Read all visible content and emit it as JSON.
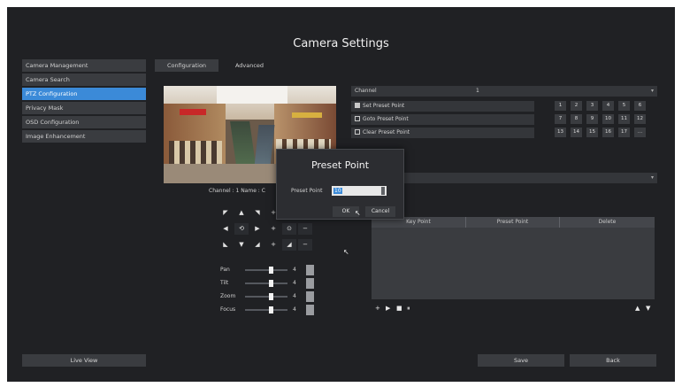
{
  "window": {
    "title": "Camera Settings"
  },
  "menu": {
    "items": [
      {
        "label": "Camera Management",
        "active": false
      },
      {
        "label": "Camera Search",
        "active": false
      },
      {
        "label": "PTZ Configuration",
        "active": true
      },
      {
        "label": "Privacy Mask",
        "active": false
      },
      {
        "label": "OSD Configuration",
        "active": false
      },
      {
        "label": "Image Enhancement",
        "active": false
      }
    ]
  },
  "tabs": [
    {
      "label": "Configuration"
    },
    {
      "label": "Advanced"
    }
  ],
  "preview": {
    "caption": "Channel : 1 Name : C"
  },
  "ptz_pad": {
    "rows": [
      [
        "◤",
        "▲",
        "◥",
        "+",
        "",
        "+"
      ],
      [
        "◀",
        "⟲",
        "▶",
        "+",
        "⊙",
        "−"
      ],
      [
        "◣",
        "▼",
        "◢",
        "+",
        "◢",
        "−"
      ]
    ]
  },
  "sliders": [
    {
      "label": "Pan",
      "value": "4"
    },
    {
      "label": "Tilt",
      "value": "4"
    },
    {
      "label": "Zoom",
      "value": "4"
    },
    {
      "label": "Focus",
      "value": "4"
    }
  ],
  "right_panel": {
    "channel_label": "Channel",
    "channel_value": "1",
    "set_preset": "Set Preset Point",
    "goto_preset": "Goto Preset Point",
    "clear_preset": "Clear Preset Point",
    "grid_rows": [
      [
        "1",
        "2",
        "3",
        "4",
        "5",
        "6"
      ],
      [
        "7",
        "8",
        "9",
        "10",
        "11",
        "12"
      ],
      [
        "13",
        "14",
        "15",
        "16",
        "17",
        "..."
      ]
    ]
  },
  "table": {
    "headers": [
      "Key Point",
      "Preset Point",
      "Delete"
    ],
    "controls": [
      "+",
      "▶",
      "■",
      "⏸"
    ],
    "nav": [
      "▲",
      "▼"
    ]
  },
  "bottom": {
    "live_view": "Live View",
    "save": "Save",
    "back": "Back"
  },
  "dialog": {
    "title": "Preset Point",
    "label": "Preset Point",
    "value": "10",
    "ok": "OK",
    "cancel": "Cancel"
  },
  "colors": {
    "background": "#202124",
    "accent": "#3b8ad8",
    "panel": "#3a3c40"
  }
}
